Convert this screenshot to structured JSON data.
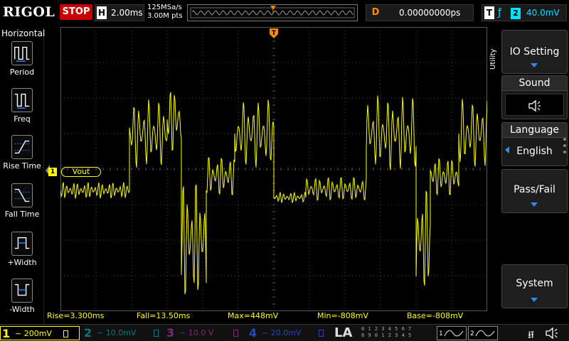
{
  "topbar": {
    "logo": "RIGOL",
    "run_state": "STOP",
    "horizontal_letter": "H",
    "timebase": "2.00ms",
    "sample_rate": "125MSa/s",
    "memory_depth": "3.00M pts",
    "trigger_marker": "T",
    "delay_letter": "D",
    "delay_value": "0.00000000ps",
    "trigger_letter": "T",
    "trigger_edge_icon": "rising-edge-icon",
    "trigger_source": "2",
    "trigger_level": "40.0mV"
  },
  "left_panel": {
    "title": "Horizontal",
    "items": [
      {
        "label": "Period",
        "icon": "period-icon"
      },
      {
        "label": "Freq",
        "icon": "frequency-icon"
      },
      {
        "label": "Rise Time",
        "icon": "rise-time-icon"
      },
      {
        "label": "Fall Time",
        "icon": "fall-time-icon"
      },
      {
        "label": "+Width",
        "icon": "positive-width-icon"
      },
      {
        "label": "-Width",
        "icon": "negative-width-icon"
      }
    ]
  },
  "waveform": {
    "channel_label": "Vout",
    "channel_number": "1",
    "trace_color": "#ffff00",
    "trigger_pos_marker": "T"
  },
  "right_panel": {
    "utility_label": "Utility",
    "io_setting": "IO Setting",
    "sound_label": "Sound",
    "sound_icon": "speaker-icon",
    "language_label": "Language",
    "language_value": "English",
    "pass_fail": "Pass/Fail",
    "system": "System"
  },
  "measurements": [
    {
      "label": "Rise=3.300ms"
    },
    {
      "label": "Fall=13.50ms"
    },
    {
      "label": "Max=448mV"
    },
    {
      "label": "Min=-808mV"
    },
    {
      "label": "Base=-808mV"
    }
  ],
  "bottombar": {
    "channels": [
      {
        "num": "1",
        "value": "~ 200mV",
        "color": "#ffff00",
        "active": true
      },
      {
        "num": "2",
        "value": "~ 10.0mV",
        "color": "#00c8d0",
        "active": false
      },
      {
        "num": "3",
        "value": "~ 10.0 V",
        "color": "#d040d0",
        "active": false
      },
      {
        "num": "4",
        "value": "~ 20.0mV",
        "color": "#3060ff",
        "active": false
      }
    ],
    "la_label": "LA",
    "digital_row1": "0 1 2 3  4 5 6 7",
    "digital_row2": "8 9 0 1  2 3 4 5",
    "gen1": "1",
    "gen2": "2",
    "usb_icon": "usb-icon"
  },
  "colors": {
    "ch1": "#ffff00",
    "trigger": "#ff8c00",
    "stop_red": "#c80000",
    "accent_blue": "#2a8cff",
    "trigger_cyan": "#00e0ff"
  }
}
